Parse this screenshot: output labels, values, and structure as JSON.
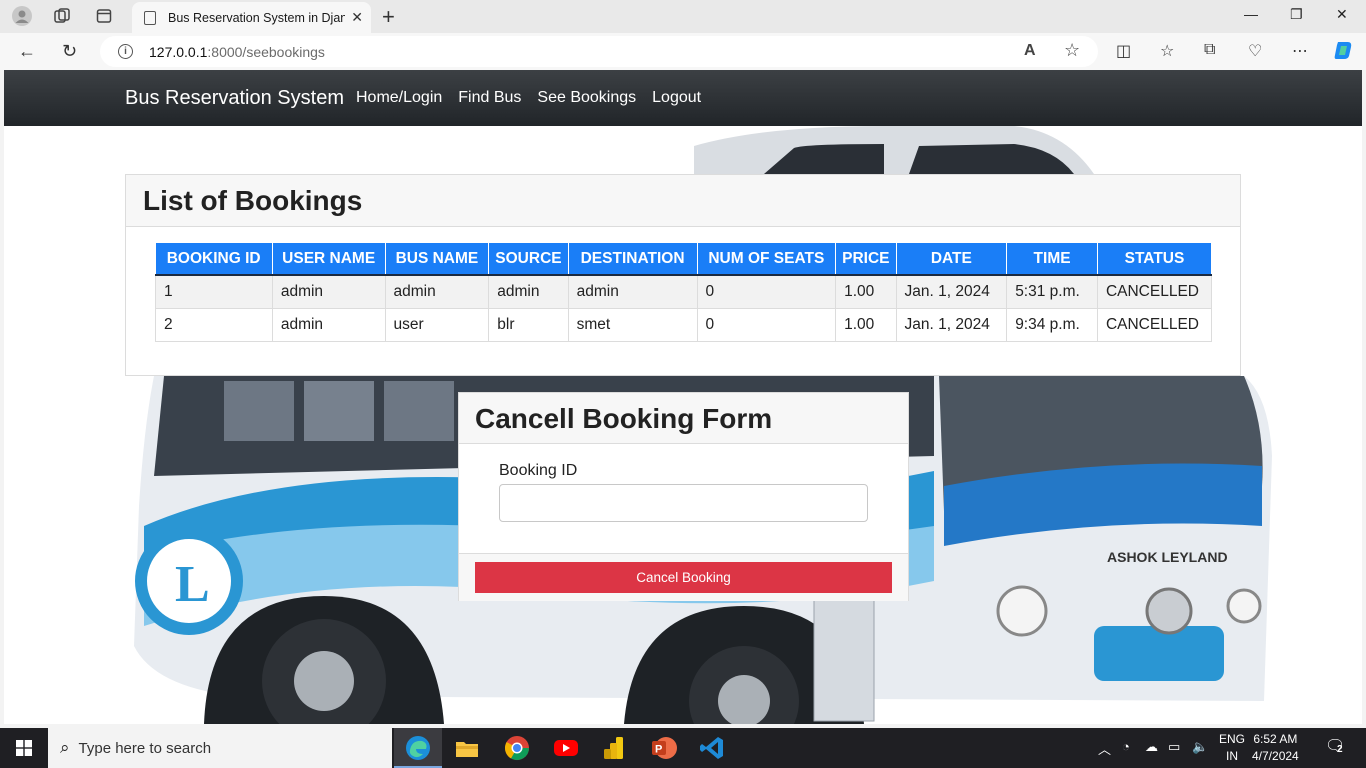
{
  "browser": {
    "tab_title": "Bus Reservation System in Django",
    "url_host": "127.0.0.1",
    "url_path": ":8000/seebookings"
  },
  "navbar": {
    "brand": "Bus Reservation System",
    "links": [
      "Home/Login",
      "Find Bus",
      "See Bookings",
      "Logout"
    ]
  },
  "bookings": {
    "title": "List of Bookings",
    "columns": [
      "BOOKING ID",
      "USER NAME",
      "BUS NAME",
      "SOURCE",
      "DESTINATION",
      "NUM OF SEATS",
      "PRICE",
      "DATE",
      "TIME",
      "STATUS"
    ],
    "rows": [
      [
        "1",
        "admin",
        "admin",
        "admin",
        "admin",
        "0",
        "1.00",
        "Jan. 1, 2024",
        "5:31 p.m.",
        "CANCELLED"
      ],
      [
        "2",
        "admin",
        "user",
        "blr",
        "smet",
        "0",
        "1.00",
        "Jan. 1, 2024",
        "9:34 p.m.",
        "CANCELLED"
      ]
    ]
  },
  "cancel_form": {
    "title": "Cancell Booking Form",
    "label": "Booking ID",
    "value": "",
    "button": "Cancel Booking"
  },
  "bus_image": {
    "brand_text": "ASHOK LEYLAND",
    "logo_letter": "L"
  },
  "taskbar": {
    "search_placeholder": "Type here to search",
    "lang_line1": "ENG",
    "lang_line2": "IN",
    "time": "6:52 AM",
    "date": "4/7/2024",
    "notifications": "2"
  }
}
